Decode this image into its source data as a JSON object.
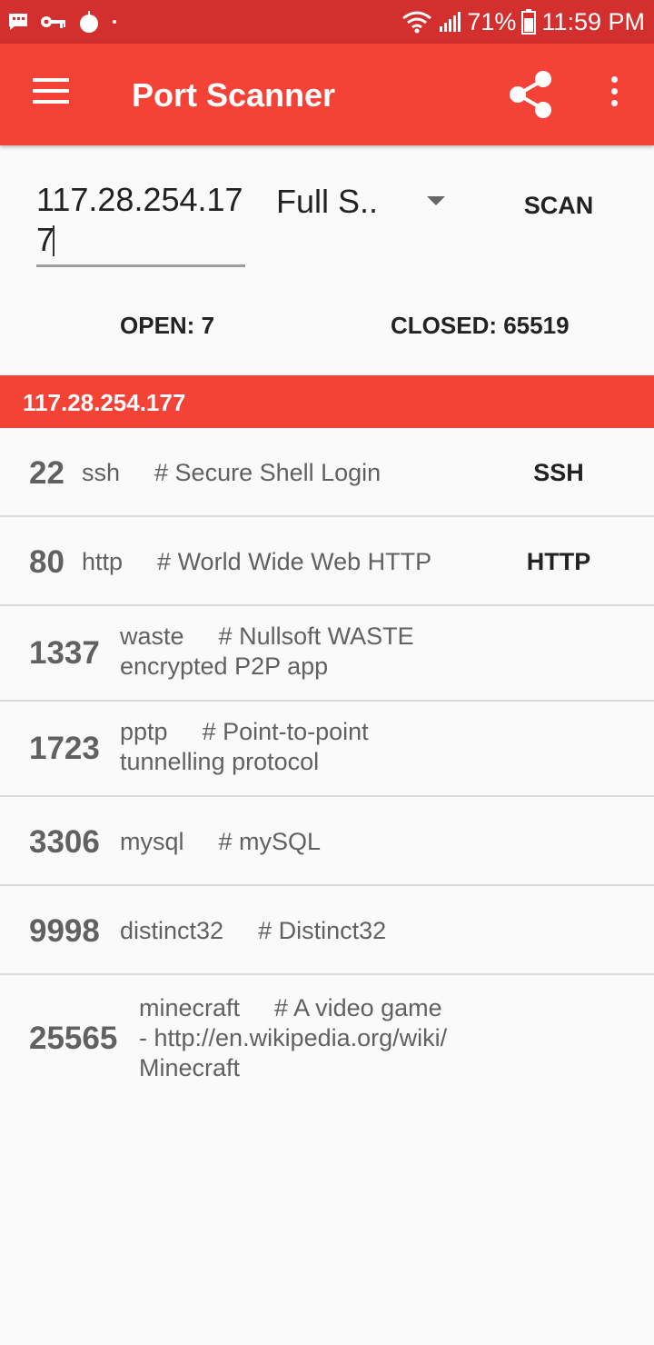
{
  "status_bar": {
    "battery": "71%",
    "time": "11:59 PM"
  },
  "app_bar": {
    "title": "Port Scanner",
    "icons": [
      "menu-icon",
      "share-icon",
      "more-vert-icon"
    ]
  },
  "scan_form": {
    "host_value": "117.28.254.177",
    "mode_value": "Full S..",
    "scan_label": "SCAN"
  },
  "stats": {
    "open": "OPEN: 7",
    "closed": "CLOSED: 65519"
  },
  "host": {
    "ip": "117.28.254.177"
  },
  "ports": [
    {
      "port": "22",
      "service": "ssh",
      "description": "# Secure Shell Login",
      "badge": "SSH"
    },
    {
      "port": "80",
      "service": "http",
      "description": "# World Wide Web HTTP",
      "badge": "HTTP"
    },
    {
      "port": "1337",
      "service": "waste",
      "description": "# Nullsoft WASTE encrypted P2P app",
      "badge": ""
    },
    {
      "port": "1723",
      "service": "pptp",
      "description": "# Point-to-point tunnelling protocol",
      "badge": ""
    },
    {
      "port": "3306",
      "service": "mysql",
      "description": "# mySQL",
      "badge": ""
    },
    {
      "port": "9998",
      "service": "distinct32",
      "description": "# Distinct32",
      "badge": ""
    },
    {
      "port": "25565",
      "service": "minecraft",
      "description": "# A video game - http://en.wikipedia.org/wiki/Minecraft",
      "badge": ""
    }
  ],
  "colors": {
    "status_bar": "#d32f2f",
    "primary": "#f44336",
    "text_dark": "#222222",
    "text_muted": "#616161"
  }
}
